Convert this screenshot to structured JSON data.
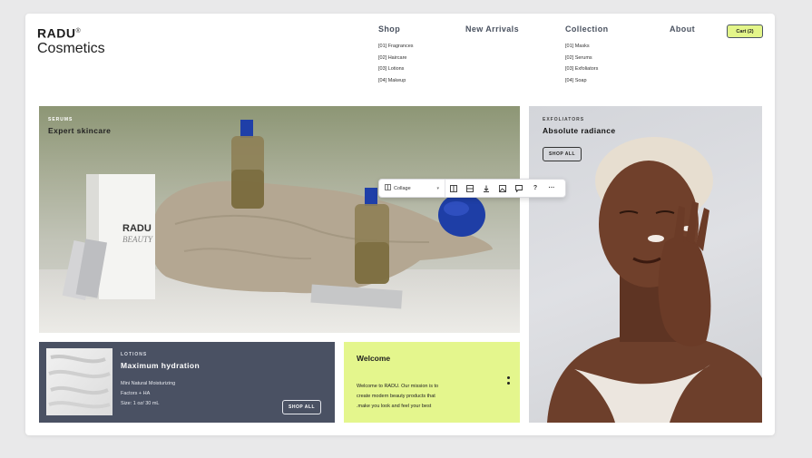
{
  "brand": {
    "line1": "RADU",
    "mark": "®",
    "line2": "Cosmetics"
  },
  "nav": [
    {
      "label": "Shop",
      "items": [
        "[01] Fragrances",
        "[02] Haircare",
        "[03] Lotions",
        "[04] Makeup"
      ]
    },
    {
      "label": "New Arrivals",
      "items": []
    },
    {
      "label": "Collection",
      "items": [
        "[01] Masks",
        "[02] Serums",
        "[03] Exfoliators",
        "[04] Soap"
      ]
    },
    {
      "label": "About",
      "items": []
    }
  ],
  "cart": {
    "label": "Cart (2)"
  },
  "hero": {
    "eyebrow": "SERUMS",
    "title": "Expert skincare",
    "product_brand": "RADU",
    "product_sub": "BEAUTY"
  },
  "exfoliators": {
    "eyebrow": "EXFOLIATORS",
    "title": "Absolute radiance",
    "button": "SHOP ALL"
  },
  "lotions": {
    "eyebrow": "LOTIONS",
    "title": "Maximum hydration",
    "desc_line1": "Mini Natural Moisturizing",
    "desc_line2": "Factors + HA",
    "desc_line3": "Size: 1 oz/ 30 mL",
    "button": "SHOP ALL"
  },
  "welcome": {
    "title": "Welcome",
    "line1": "Welcome to RADU. Our mission is to",
    "line2": "create modern beauty products that",
    "line3": ".make you look and feel your best"
  },
  "toolbar": {
    "layout_label": "Collage",
    "icons": [
      "layout-icon",
      "image-layers-icon",
      "download-icon",
      "image-icon",
      "comment-icon",
      "help-icon",
      "more-icon"
    ],
    "help_glyph": "?",
    "more_glyph": "···"
  },
  "colors": {
    "accent": "#e3f58a",
    "slate": "#4a5163",
    "background": "#e9e9ea"
  }
}
